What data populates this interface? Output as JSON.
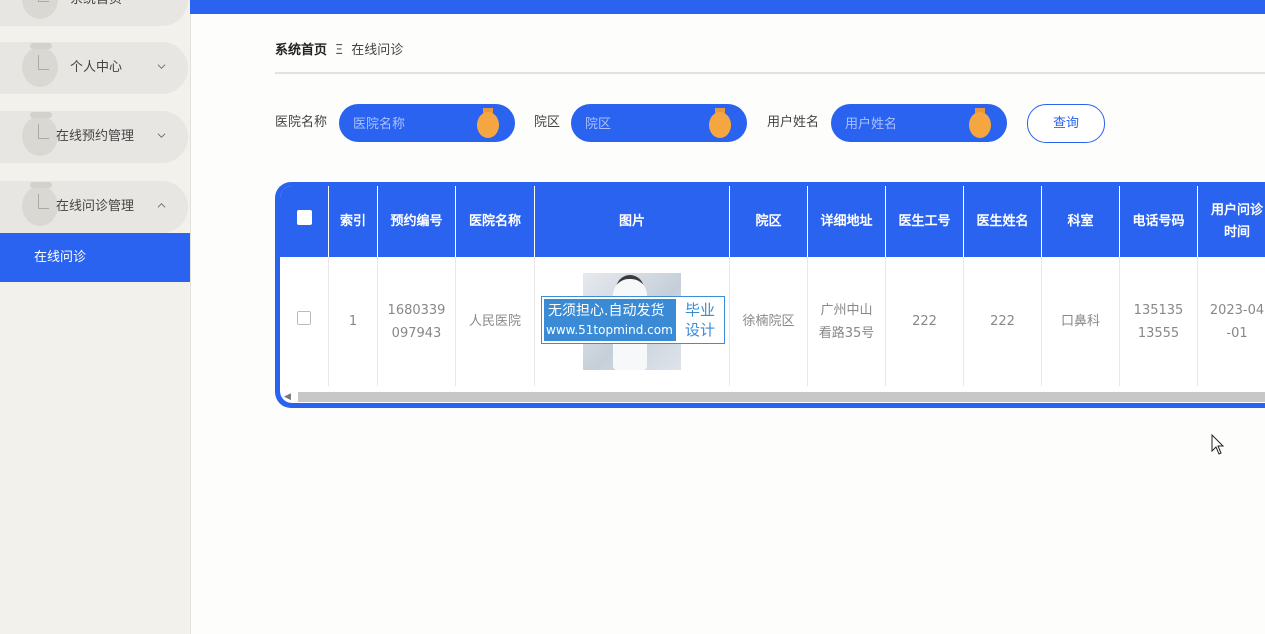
{
  "sidebar": {
    "items": [
      {
        "label": "系统首页"
      },
      {
        "label": "个人中心"
      },
      {
        "label": "在线预约管理"
      },
      {
        "label": "在线问诊管理"
      }
    ],
    "submenu_active": "在线问诊"
  },
  "breadcrumb": {
    "home": "系统首页",
    "separator": "Ξ",
    "current": "在线问诊"
  },
  "search": {
    "fields": [
      {
        "label": "医院名称",
        "placeholder": "医院名称",
        "value": ""
      },
      {
        "label": "院区",
        "placeholder": "院区",
        "value": ""
      },
      {
        "label": "用户姓名",
        "placeholder": "用户姓名",
        "value": ""
      }
    ],
    "button_label": "查询"
  },
  "table": {
    "headers": [
      "索引",
      "预约编号",
      "医院名称",
      "图片",
      "院区",
      "详细地址",
      "医生工号",
      "医生姓名",
      "科室",
      "电话号码",
      "用户问诊时间"
    ],
    "rows": [
      {
        "index": "1",
        "appointment_no": "1680339097943",
        "hospital": "人民医院",
        "campus": "徐楠院区",
        "address": "广州中山看路35号",
        "doctor_id": "222",
        "doctor_name": "222",
        "department": "口鼻科",
        "phone": "13513513555",
        "consult_time": "2023-04-01"
      }
    ]
  },
  "watermark": {
    "line1": "无须担心.自动发货",
    "line2": "www.51topmind.com",
    "right1": "毕业",
    "right2": "设计"
  },
  "colors": {
    "primary": "#2a63f0",
    "accent_knob": "#f6a641",
    "sidebar_bg": "#f3f1ec"
  },
  "icons": {
    "chevron": "chevron-down-icon",
    "chevron_open": "chevron-up-icon"
  }
}
